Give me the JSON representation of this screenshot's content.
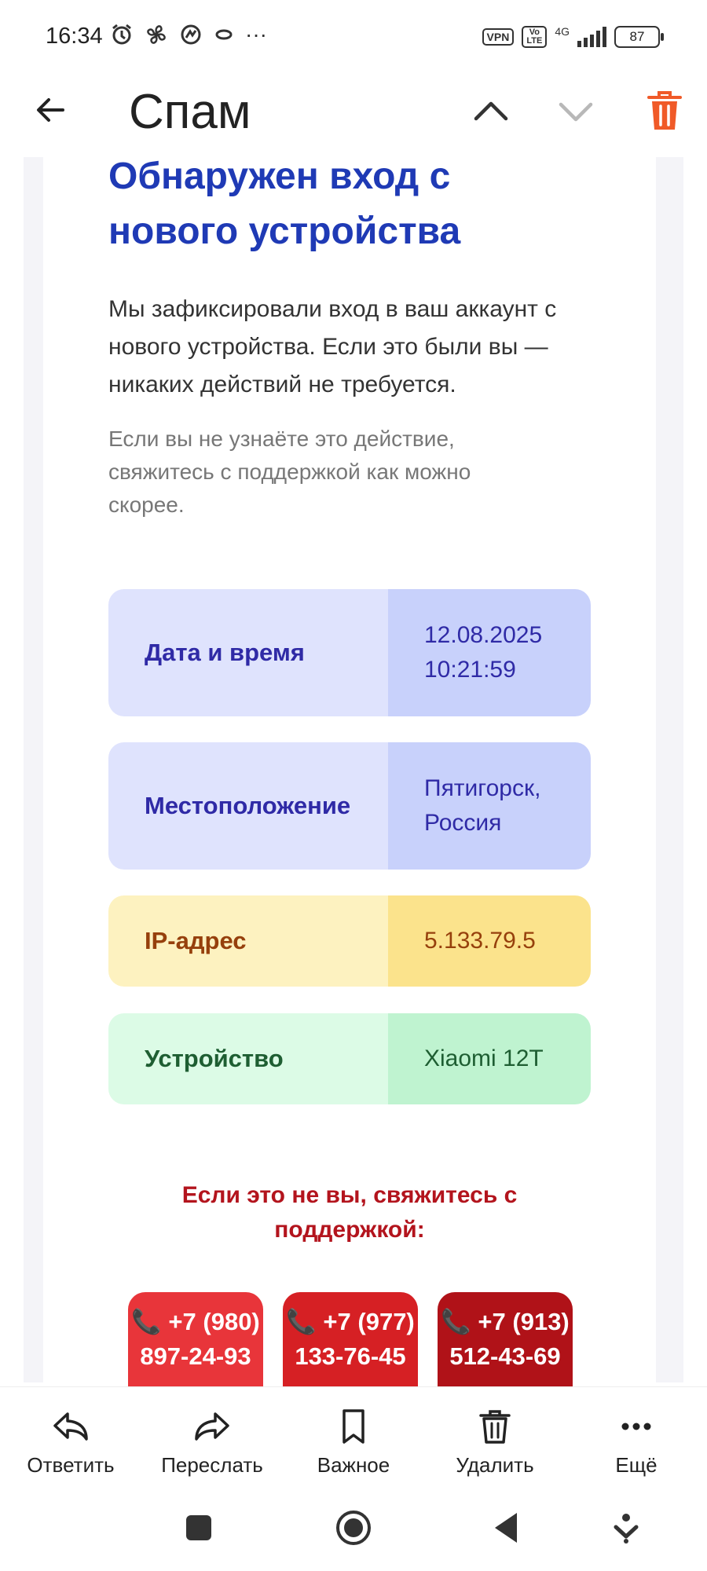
{
  "status_bar": {
    "time": "16:34",
    "vpn_label": "VPN",
    "volte_label": "Vo LTE",
    "network_label": "4G",
    "battery_level": "87",
    "more_icons": "···"
  },
  "header": {
    "title": "Спам"
  },
  "email": {
    "headline": "Обнаружен вход с нового устройства",
    "paragraph1": "Мы зафиксировали вход в ваш аккаунт с нового устройства. Если это были вы — никаких действий не требуется.",
    "paragraph2": "Если вы не узнаёте это действие, свяжитесь с поддержкой как можно скорее.",
    "info_rows": [
      {
        "label": "Дата и время",
        "value": "12.08.2025\n10:21:59"
      },
      {
        "label": "Местоположение",
        "value": "Пятигорск,\nРоссия"
      },
      {
        "label": "IP-адрес",
        "value": "5.133.79.5"
      },
      {
        "label": "Устройство",
        "value": "Xiaomi 12T"
      }
    ],
    "warning": "Если это не вы, свяжитесь с поддержкой:",
    "phones": [
      {
        "line1": "📞 +7 (980)",
        "line2": "897-24-93",
        "color": "#e8353a"
      },
      {
        "line1": "📞 +7 (977)",
        "line2": "133-76-45",
        "color": "#d62024"
      },
      {
        "line1": "📞 +7 (913)",
        "line2": "512-43-69",
        "color": "#b01218"
      }
    ]
  },
  "toolbar": {
    "reply": "Ответить",
    "forward": "Переслать",
    "important": "Важное",
    "delete": "Удалить",
    "more": "Ещё"
  },
  "colors": {
    "headline": "#1f3ab5",
    "trash_accent": "#f05a28",
    "warning": "#b3141d"
  }
}
